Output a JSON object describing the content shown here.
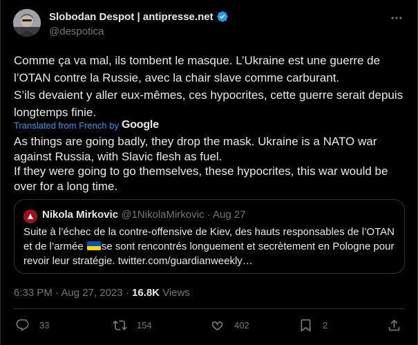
{
  "author": {
    "display_name": "Slobodan Despot | antipresse.net",
    "handle": "@despotica"
  },
  "more_icon": "ellipsis-icon",
  "tweet": {
    "original_lines": [
      "Comme ça va mal, ils tombent le masque. L’Ukraine est une guerre de l’OTAN contre la Russie, avec la chair slave comme carburant.",
      "S’ils devaient y aller eux-mêmes, ces hypocrites, cette guerre serait depuis longtemps finie."
    ],
    "translated_label": "Translated from French by",
    "translator": "Google",
    "translated_lines": [
      "As things are going badly, they drop the mask. Ukraine is a NATO war against Russia, with Slavic flesh as fuel.",
      "If they were going to go themselves, these hypocrites, this war would be over for a long time."
    ]
  },
  "quote": {
    "name": "Nikola Mirkovic",
    "handle": "@1NikolaMirkovic",
    "sep": "·",
    "date": "Aug 27",
    "text_before_flag": "Suite à l’échec de la contre-offensive de Kiev, des hauts responsables de l’OTAN et de l’armée ",
    "text_after_flag": "se sont rencontrés longuement et secrètement en Pologne pour revoir leur stratégie. twitter.com/guardianweekly…"
  },
  "meta": {
    "time": "6:33 PM",
    "sep": "·",
    "date": "Aug 27, 2023",
    "views_count": "16.8K",
    "views_label": "Views"
  },
  "actions": {
    "replies": "33",
    "retweets": "154",
    "likes": "402",
    "bookmarks": "2"
  },
  "colors": {
    "accent": "#1d9bf0",
    "muted": "#71767b",
    "text": "#e7e9ea",
    "border": "#2f3336"
  }
}
